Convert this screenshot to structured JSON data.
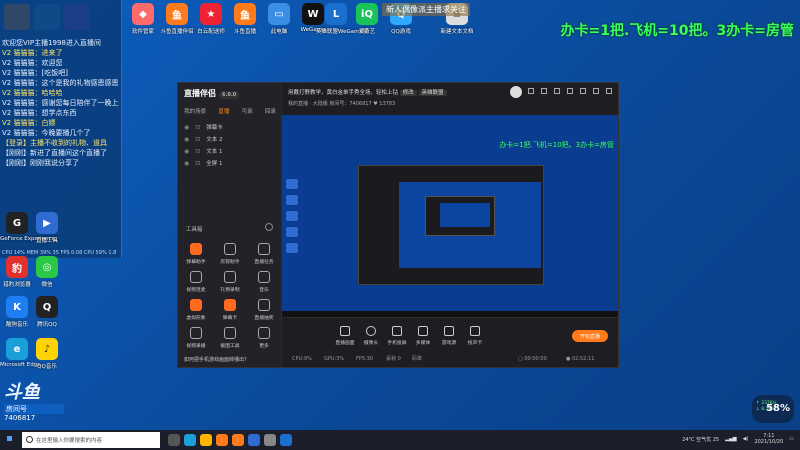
{
  "desktop": {
    "banner": "新人偶像派主播求关注",
    "slogan": "办卡=1把.飞机=10把。3办卡=房管",
    "icons": [
      {
        "label": "软件管家",
        "color": "#ff6b6b",
        "glyph": "◆"
      },
      {
        "label": "斗鱼直播伴侣",
        "color": "#ff7a1a",
        "glyph": "鱼"
      },
      {
        "label": "白云配送师",
        "color": "#e23",
        "glyph": "★"
      },
      {
        "label": "斗鱼直播",
        "color": "#ff7a1a",
        "glyph": "鱼"
      },
      {
        "label": "此电脑",
        "color": "#3a8ee6",
        "glyph": "▭"
      },
      {
        "label": "WeGame",
        "color": "#111",
        "glyph": "W"
      },
      {
        "label": "英雄联盟WeGame版",
        "color": "#1b6fcf",
        "glyph": "L"
      },
      {
        "label": "爱奇艺",
        "color": "#19c35a",
        "glyph": "iQ"
      },
      {
        "label": "QQ游戏",
        "color": "#2fa8ff",
        "glyph": "Q"
      },
      {
        "label": "新建文本文档",
        "color": "#ddd",
        "glyph": "≡"
      },
      {
        "label": "猎豹浏览器",
        "color": "#e2302c",
        "glyph": "豹"
      },
      {
        "label": "微信",
        "color": "#2ac845",
        "glyph": "◎"
      },
      {
        "label": "酷狗音乐",
        "color": "#1f7ef1",
        "glyph": "K"
      },
      {
        "label": "腾讯QQ",
        "color": "#222",
        "glyph": "Q"
      },
      {
        "label": "Microsoft Edge",
        "color": "#1aa0d8",
        "glyph": "e"
      },
      {
        "label": "QQ音乐",
        "color": "#ffd400",
        "glyph": "♪"
      },
      {
        "label": "GeForce Experience",
        "color": "#222",
        "glyph": "G"
      },
      {
        "label": "直播工具",
        "color": "#2f6bd0",
        "glyph": "▶"
      }
    ]
  },
  "ticker": {
    "lines": [
      {
        "text": "欢迎您VIP主播1998进入直播间",
        "hl": false
      },
      {
        "text": "V2 猫猫猫：进来了",
        "hl": true
      },
      {
        "text": "V2 猫猫猫：欢迎您",
        "hl": false
      },
      {
        "text": "V2 猫猫猫：[吃饭吧]",
        "hl": false
      },
      {
        "text": "V2 猫猫猫：这个是我的礼物感恩感恩[亲亲]",
        "hl": false
      },
      {
        "text": "V2 猫猫猫：哈哈哈",
        "hl": true
      },
      {
        "text": "V2 猫猫猫：感谢您每日陪伴了一晚上",
        "hl": false
      },
      {
        "text": "V2 猫猫猫：想学点东西",
        "hl": false
      },
      {
        "text": "V2 猫猫猫：白嫖",
        "hl": true
      },
      {
        "text": "V2 猫猫猫：今晚要播几个了",
        "hl": false
      },
      {
        "text": "【登录】主播不收到的礼物、道具",
        "hl": true
      },
      {
        "text": "【刚刚】新进了直播间这个直播了",
        "hl": false
      },
      {
        "text": "【刚刚】刚刚我说分享了",
        "hl": false
      }
    ],
    "status": "CPU 14% MEM 39% 35 FPS 0.08 CPU 59% 1.8"
  },
  "app": {
    "title": "直播伴侣",
    "version": "6.0.0",
    "left_tabs": [
      "我的场景",
      "直播",
      "可录",
      "回录"
    ],
    "scenes": [
      "弹幕卡",
      "文本 2",
      "文本 1",
      "全屏 1"
    ],
    "tools_title": "工具箱",
    "tools": [
      {
        "label": "弹幕助手",
        "orange": true
      },
      {
        "label": "房管助手",
        "orange": false
      },
      {
        "label": "直播任务",
        "orange": false
      },
      {
        "label": "视频连麦",
        "orange": false
      },
      {
        "label": "礼物录制",
        "orange": false
      },
      {
        "label": "音乐",
        "orange": false
      },
      {
        "label": "虚拟形象",
        "orange": false
      },
      {
        "label": "弹幕卡",
        "orange": false
      },
      {
        "label": "直播抽奖",
        "orange": false
      },
      {
        "label": "视频录播",
        "orange": false
      },
      {
        "label": "截图工具",
        "orange": false
      },
      {
        "label": "更多",
        "orange": false
      }
    ],
    "tip": "如何把手机游戏画面转播出？",
    "topbar_title": "用戴打野教学，黄白金单手秀全场，轻松上钻",
    "topbar_edit": "修改",
    "topbar_category": "英雄联盟",
    "topbar_sub": "我的直播 · 大陆版  房间号：7406817  ♥ 13783",
    "preview_slogan": "办卡=1把.飞机=10把。3办卡=房管",
    "bottom_tools": [
      "直播画面",
      "摄像头",
      "手机投屏",
      "多媒体",
      "游戏源",
      "投声卡"
    ],
    "live_button": "开始直播",
    "stats": [
      "CPU:9%",
      "GPU:3%",
      "FPS:30",
      "丢帧 0",
      "码率",
      "▢ 00:00:00",
      "● 02:52:11"
    ]
  },
  "corner": {
    "big": "斗鱼",
    "name": "房间号",
    "id": "7406817"
  },
  "widget": {
    "pct": "58%",
    "up": "↑ 237K/s",
    "down": "↓ 8.1K/s"
  },
  "taskbar": {
    "search_placeholder": "在这里输入你要搜索的内容",
    "weather": "24°C 空气优 25",
    "time": "7:11",
    "date": "2021/10/20"
  }
}
